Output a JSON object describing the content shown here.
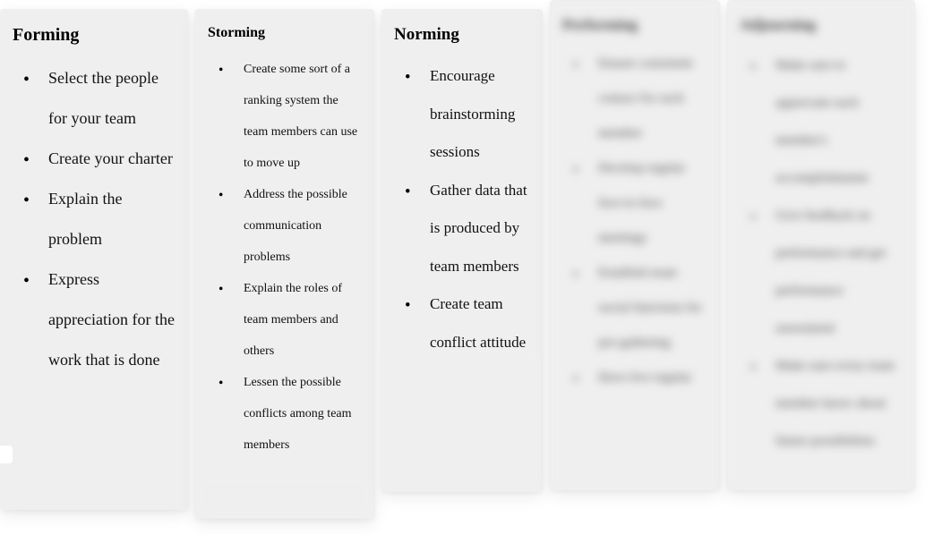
{
  "columns": [
    {
      "title": "Forming",
      "items": [
        "Select the people for your team",
        "Create your charter",
        "Explain the problem",
        "Express appreciation for the work that is done"
      ]
    },
    {
      "title": "Storming",
      "items": [
        "Create some sort of a ranking system the team members can use to move up",
        "Address the possible communication problems",
        "Explain the roles of team members and others",
        "Lessen the possible conflicts among team members"
      ]
    },
    {
      "title": "Norming",
      "items": [
        "Encourage brainstorming sessions",
        "Gather data that is produced by team members",
        "Create team conflict attitude"
      ]
    },
    {
      "title": "Performing",
      "items": [
        "Ensure consistent contact for each member",
        "Develop regular face-to-face meetings",
        "Establish team social functions for pre-gathering",
        "Have live regular"
      ]
    },
    {
      "title": "Adjourning",
      "items": [
        "Make sure to appreciate each member's accomplishments",
        "Give feedback on performance and get performance assessment",
        "Make sure every team member know about future possibilities"
      ]
    }
  ]
}
